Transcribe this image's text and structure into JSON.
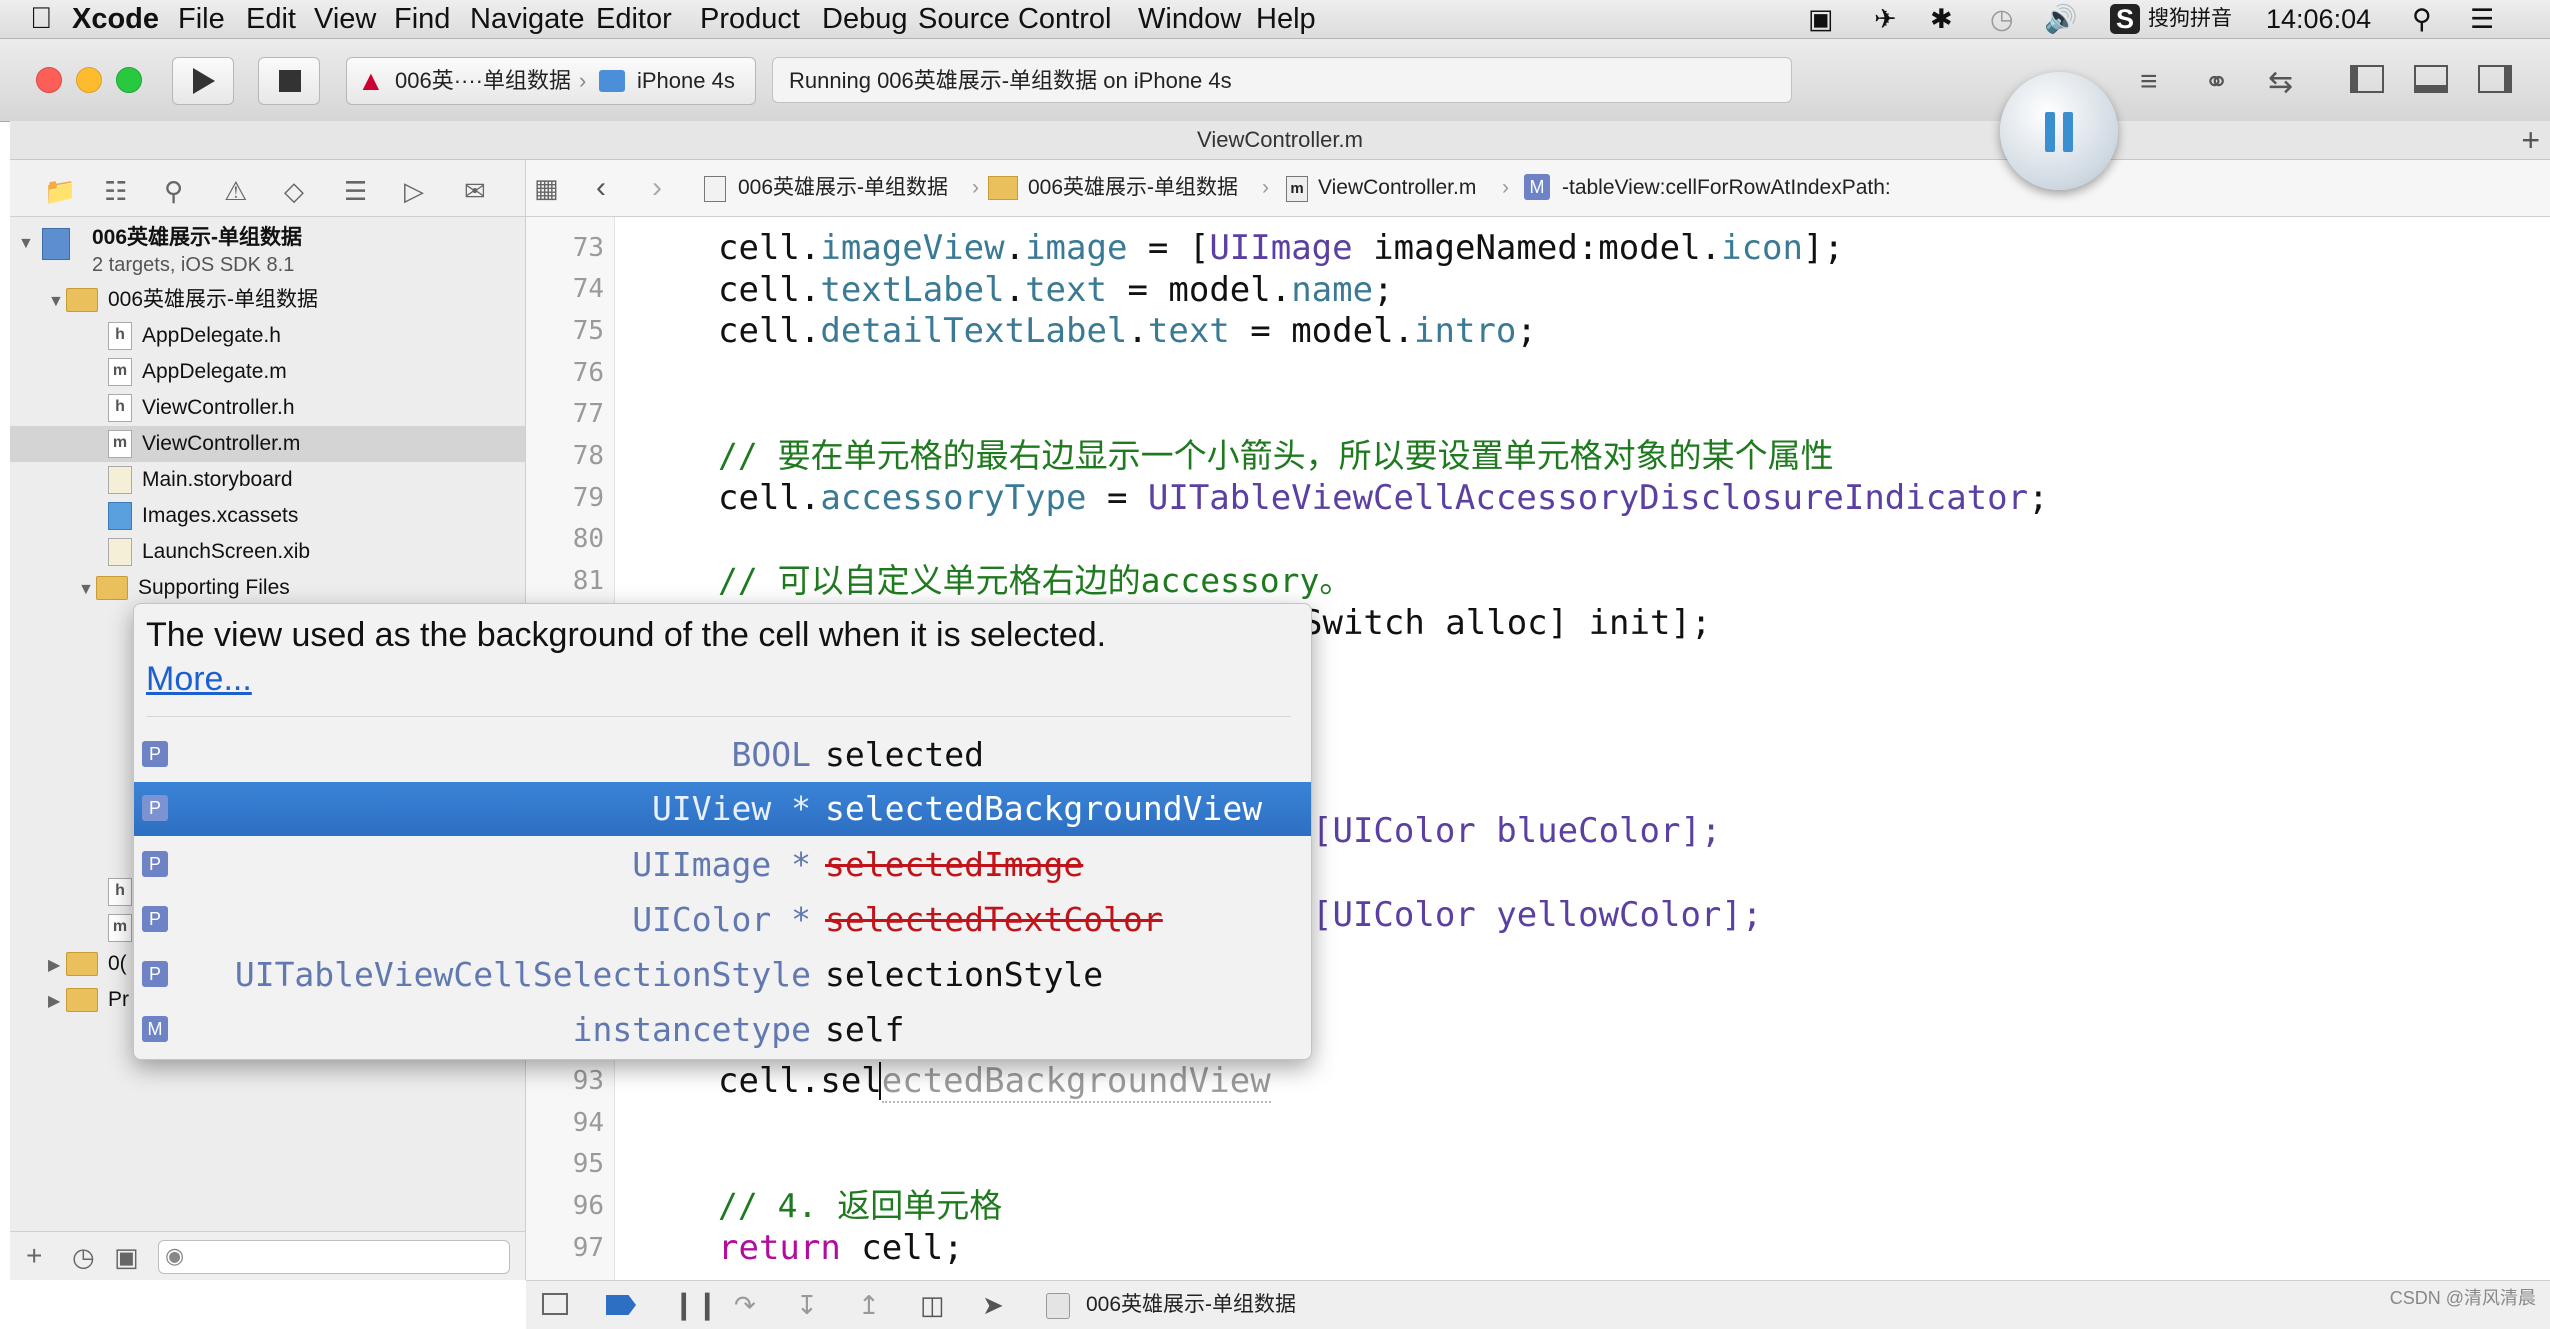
{
  "menubar": {
    "apple_icon": "apple-icon",
    "app_name": "Xcode",
    "items": [
      "File",
      "Edit",
      "View",
      "Find",
      "Navigate",
      "Editor",
      "Product",
      "Debug",
      "Source Control",
      "Window",
      "Help"
    ],
    "input_method": "搜狗拼音",
    "clock": "14:06:04"
  },
  "toolbar": {
    "scheme_project": "006英····单组数据",
    "scheme_device": "iPhone 4s",
    "activity_text": "Running 006英雄展示-单组数据 on iPhone 4s"
  },
  "tabbar": {
    "title": "ViewController.m",
    "add_label": "+"
  },
  "navigator": {
    "project_name": "006英雄展示-单组数据",
    "project_subtitle": "2 targets, iOS SDK 8.1",
    "group_name": "006英雄展示-单组数据",
    "files": [
      {
        "icon": "h",
        "name": "AppDelegate.h"
      },
      {
        "icon": "m",
        "name": "AppDelegate.m"
      },
      {
        "icon": "h",
        "name": "ViewController.h"
      },
      {
        "icon": "m",
        "name": "ViewController.m"
      },
      {
        "icon": "",
        "name": "Main.storyboard"
      },
      {
        "icon": "",
        "name": "Images.xcassets"
      },
      {
        "icon": "",
        "name": "LaunchScreen.xib"
      }
    ],
    "supporting_files": "Supporting Files",
    "partial_rows": [
      "h",
      "m",
      "0(",
      "Pr"
    ]
  },
  "jumpbar": {
    "crumbs": [
      "006英雄展示-单组数据",
      "006英雄展示-单组数据",
      "ViewController.m",
      "-tableView:cellForRowAtIndexPath:"
    ],
    "method_badge": "M"
  },
  "editor": {
    "line_numbers": [
      "73",
      "74",
      "75",
      "76",
      "77",
      "78",
      "79",
      "80",
      "81",
      "93",
      "94",
      "95",
      "96",
      "97"
    ],
    "lines": {
      "l73": {
        "a": "cell.",
        "b": "imageView",
        "c": ".",
        "d": "image",
        "e": " = [",
        "f": "UIImage",
        "g": " imageNamed:model.",
        "h": "icon",
        "i": "];"
      },
      "l74": {
        "a": "cell.",
        "b": "textLabel",
        "c": ".",
        "d": "text",
        "e": " = model.",
        "f": "name",
        "g": ";"
      },
      "l75": {
        "a": "cell.",
        "b": "detailTextLabel",
        "c": ".",
        "d": "text",
        "e": " = model.",
        "f": "intro",
        "g": ";"
      },
      "l78": "// 要在单元格的最右边显示一个小箭头，所以要设置单元格对象的某个属性",
      "l79": {
        "a": "cell.",
        "b": "accessoryType",
        "c": " = ",
        "d": "UITableViewCellAccessoryDisclosureIndicator",
        "e": ";"
      },
      "l81": "// 可以自定义单元格右边的accessory。",
      "l82_tail": "Switch alloc] init];",
      "l86_tail": "[UIColor blueColor];",
      "l88_tail": "[UIColor yellowColor];",
      "l93": {
        "typed": "cell.sel",
        "ghost": "ectedBackgroundView"
      },
      "l96": "// 4. 返回单元格",
      "l97": {
        "kw": "return",
        "rest": " cell;"
      }
    }
  },
  "completion": {
    "description": "The view used as the background of the cell when it is selected.",
    "more_link": "More...",
    "items": [
      {
        "badge": "P",
        "type": "BOOL",
        "name": "selected",
        "deprecated": false
      },
      {
        "badge": "P",
        "type": "UIView *",
        "name": "selectedBackgroundView",
        "deprecated": false,
        "selected": true
      },
      {
        "badge": "P",
        "type": "UIImage *",
        "name": "selectedImage",
        "deprecated": true
      },
      {
        "badge": "P",
        "type": "UIColor *",
        "name": "selectedTextColor",
        "deprecated": true
      },
      {
        "badge": "P",
        "type": "UITableViewCellSelectionStyle",
        "name": "selectionStyle",
        "deprecated": false
      },
      {
        "badge": "M",
        "type": "instancetype",
        "name": "self",
        "deprecated": false
      }
    ]
  },
  "bottombar": {
    "target_label": "006英雄展示-单组数据"
  },
  "watermark": "CSDN @清风清晨",
  "colors": {
    "selection": "#2c6fc3",
    "comment": "#1f7a1f",
    "keyword": "#b20e9e",
    "deprecated": "#c0141a"
  }
}
